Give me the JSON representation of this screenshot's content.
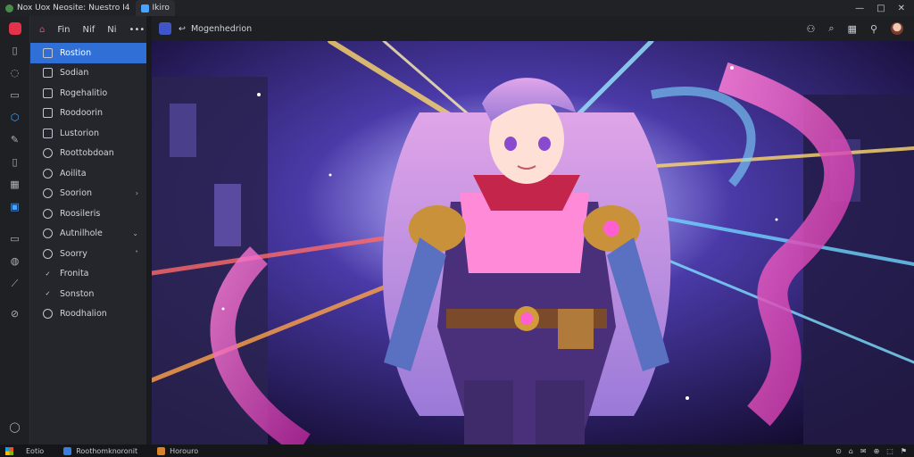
{
  "window": {
    "tabs": [
      {
        "label": "Nox Uox Neosite: Nuestro I4",
        "active": false
      },
      {
        "label": "Ikiro",
        "active": true
      }
    ],
    "controls": [
      "—",
      "□",
      "✕"
    ]
  },
  "rail": {
    "icons": [
      "app-logo",
      "file-icon",
      "chat-icon",
      "doc-icon",
      "cube-icon",
      "pen-icon",
      "page-icon",
      "image-icon",
      "window-icon",
      "monitor-icon",
      "palette-icon",
      "brush-icon",
      "compass-icon",
      "help-icon"
    ]
  },
  "sidebar": {
    "header": {
      "home_icon": "home-icon",
      "item1": "Fin",
      "item2": "Nif",
      "item3": "Ni",
      "more": "•••"
    },
    "items": [
      {
        "label": "Rostion",
        "icon": "user-icon",
        "active": true,
        "chevron": ""
      },
      {
        "label": "Sodian",
        "icon": "folder-icon",
        "active": false,
        "chevron": ""
      },
      {
        "label": "Rogehalitio",
        "icon": "grid-icon",
        "active": false,
        "chevron": ""
      },
      {
        "label": "Roodoorin",
        "icon": "box-icon",
        "active": false,
        "chevron": ""
      },
      {
        "label": "Lustorion",
        "icon": "box-icon",
        "active": false,
        "chevron": ""
      },
      {
        "label": "Roottobdoan",
        "icon": "circle-icon",
        "active": false,
        "chevron": ""
      },
      {
        "label": "Aoilita",
        "icon": "circle-icon",
        "active": false,
        "chevron": ""
      },
      {
        "label": "Soorion",
        "icon": "circle-icon",
        "active": false,
        "chevron": "›"
      },
      {
        "label": "Roosileris",
        "icon": "circle-icon",
        "active": false,
        "chevron": ""
      },
      {
        "label": "Autnilhole",
        "icon": "circle-icon",
        "active": false,
        "chevron": "⌄"
      },
      {
        "label": "Soorry",
        "icon": "circle-icon",
        "active": false,
        "chevron": "˄"
      },
      {
        "label": "Fronita",
        "icon": "check-icon",
        "active": false,
        "chevron": ""
      },
      {
        "label": "Sonston",
        "icon": "check-icon",
        "active": false,
        "chevron": ""
      },
      {
        "label": "Roodhalion",
        "icon": "circle-icon",
        "active": false,
        "chevron": ""
      }
    ]
  },
  "main": {
    "toolbar": {
      "title": "Mogenhedrion",
      "nav_icon": "back-icon"
    },
    "actions": [
      "user-plus-icon",
      "search-icon",
      "grid-icon",
      "pin-icon",
      "avatar"
    ]
  },
  "taskbar": {
    "apps": [
      {
        "label": "Eotio",
        "color": "#2a6fe0"
      },
      {
        "label": "Roothomknoronit",
        "color": "#3a7de0"
      },
      {
        "label": "Horouro",
        "color": "#d9822b"
      }
    ],
    "tray": [
      "⊙",
      "⌂",
      "✉",
      "⊕",
      "⬚",
      "⚑"
    ]
  },
  "colors": {
    "accent": "#2f6fd6",
    "brand": "#e5324b",
    "sidebar_bg": "#24262b",
    "hair": "#c98fd8",
    "magic": "#ff63c8"
  }
}
